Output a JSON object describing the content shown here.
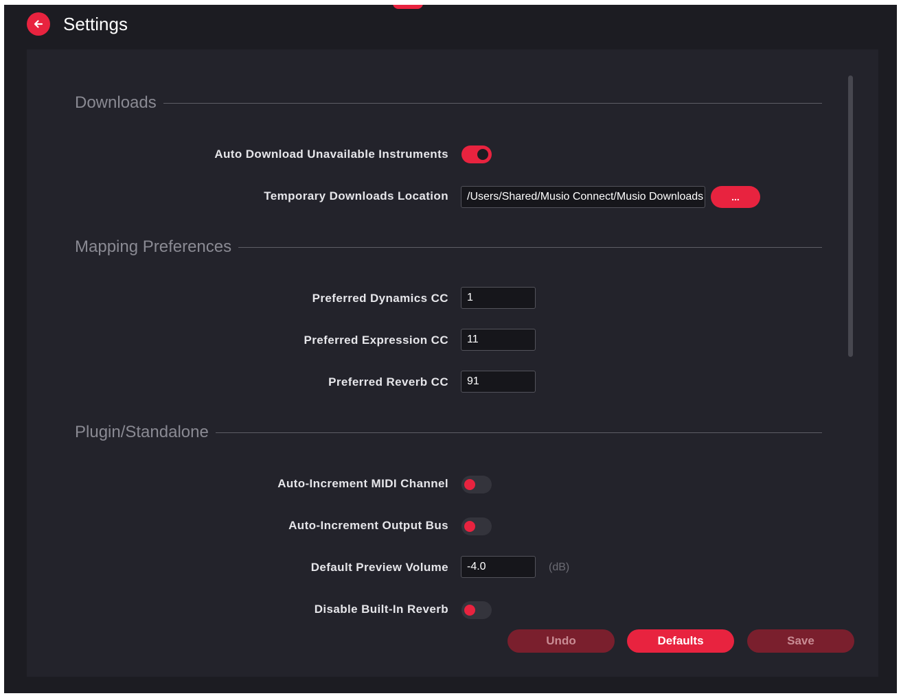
{
  "header": {
    "title": "Settings",
    "back_icon": "arrow-left-icon"
  },
  "sections": {
    "downloads": {
      "title": "Downloads",
      "auto_download": {
        "label": "Auto Download Unavailable Instruments",
        "on": true
      },
      "temp_location": {
        "label": "Temporary Downloads Location",
        "value": "/Users/Shared/Musio Connect/Musio Downloads",
        "browse_label": "..."
      }
    },
    "mapping": {
      "title": "Mapping Preferences",
      "dynamics": {
        "label": "Preferred Dynamics CC",
        "value": "1"
      },
      "expression": {
        "label": "Preferred Expression CC",
        "value": "11"
      },
      "reverb": {
        "label": "Preferred Reverb CC",
        "value": "91"
      }
    },
    "plugin": {
      "title": "Plugin/Standalone",
      "midi_channel": {
        "label": "Auto-Increment MIDI Channel",
        "on": false
      },
      "output_bus": {
        "label": "Auto-Increment Output Bus",
        "on": false
      },
      "preview_volume": {
        "label": "Default Preview Volume",
        "value": "-4.0",
        "unit": "(dB)"
      },
      "builtin_reverb": {
        "label": "Disable Built-In Reverb",
        "on": false
      }
    }
  },
  "actions": {
    "undo": "Undo",
    "defaults": "Defaults",
    "save": "Save"
  },
  "colors": {
    "accent": "#e8233f",
    "accent_disabled": "#7a1f2d",
    "background": "#1c1c22",
    "panel": "#23232b"
  }
}
